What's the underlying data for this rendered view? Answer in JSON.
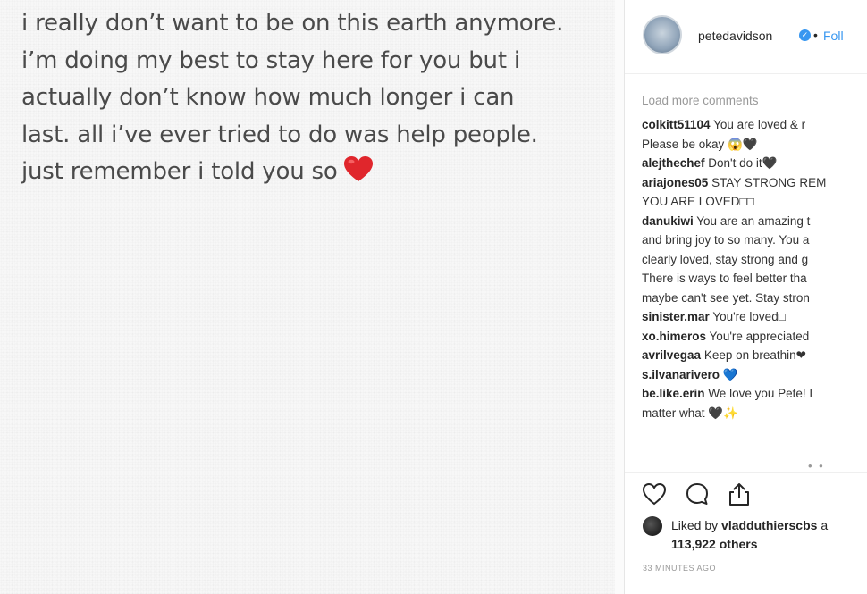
{
  "note": {
    "lines": [
      "i really don’t want to be on this earth anymore.",
      "i’m doing my best to stay here for you but i",
      "actually don’t know how much longer i can",
      "last. all i’ve ever tried to do was help people.",
      "just remember i told you so"
    ],
    "emoji": "red-heart"
  },
  "header": {
    "username": "petedavidson",
    "verified": true,
    "separator": "•",
    "follow_label": "Foll"
  },
  "comments": {
    "load_more": "Load more comments",
    "items": [
      {
        "user": "colkitt51104",
        "lines": [
          "You are loved & r",
          "Please be okay 😱🖤"
        ]
      },
      {
        "user": "alejthechef",
        "lines": [
          "Don't do it🖤"
        ]
      },
      {
        "user": "ariajones05",
        "lines": [
          "STAY STRONG REM",
          "YOU ARE LOVED□□"
        ]
      },
      {
        "user": "danukiwi",
        "lines": [
          "You are an amazing t",
          "and bring joy to so many. You a",
          "clearly loved, stay strong and g",
          "There is ways to feel better tha",
          "maybe can't see yet. Stay stron"
        ]
      },
      {
        "user": "sinister.mar",
        "lines": [
          "You're loved□"
        ]
      },
      {
        "user": "xo.himeros",
        "lines": [
          "You're appreciated"
        ]
      },
      {
        "user": "avrilvegaa",
        "lines": [
          "Keep on breathin❤"
        ]
      },
      {
        "user": "s.ilvanarivero",
        "lines": [
          "💙"
        ]
      },
      {
        "user": "be.like.erin",
        "lines": [
          "We love you Pete! I",
          "matter what 🖤✨"
        ]
      }
    ],
    "more": "• •"
  },
  "likes": {
    "prefix": "Liked by",
    "user": "vladduthierscbs",
    "suffix": "a",
    "count_line": "113,922 others"
  },
  "timestamp": "33 MINUTES AGO",
  "colors": {
    "accent": "#3897f0",
    "heart": "#e0262c",
    "text": "#262626"
  }
}
